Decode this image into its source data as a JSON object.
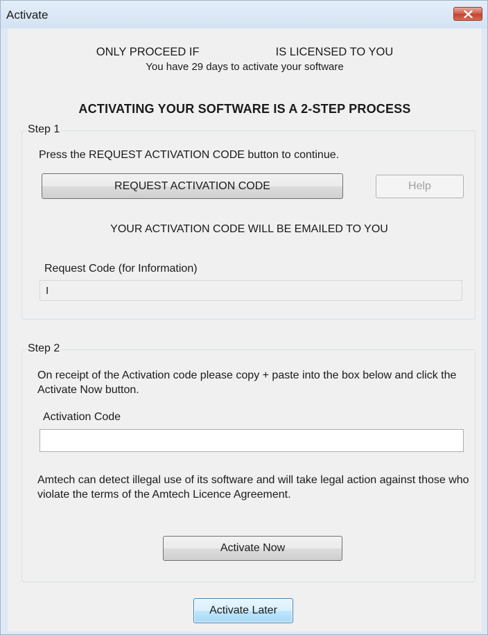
{
  "window": {
    "title": "Activate"
  },
  "header": {
    "warning_left": "ONLY PROCEED IF",
    "warning_right": "IS LICENSED TO YOU",
    "days_remaining": "You have 29 days to activate your software",
    "process_heading": "ACTIVATING YOUR SOFTWARE IS A 2-STEP PROCESS"
  },
  "step1": {
    "legend": "Step 1",
    "instruction": "Press the REQUEST ACTIVATION CODE button to continue.",
    "request_button": "REQUEST ACTIVATION CODE",
    "help_button": "Help",
    "email_notice": "YOUR ACTIVATION CODE WILL BE EMAILED TO YOU",
    "request_code_label": "Request Code (for Information)",
    "request_code_value": "I"
  },
  "step2": {
    "legend": "Step 2",
    "instruction": "On receipt of the Activation code please copy + paste into the box below and click the Activate Now button.",
    "activation_code_label": "Activation Code",
    "activation_code_value": "",
    "legal_notice": "Amtech can detect illegal use of its software and will take legal action against those who violate the terms of the Amtech Licence Agreement.",
    "activate_now_button": "Activate Now"
  },
  "footer": {
    "activate_later_button": "Activate Later"
  },
  "colors": {
    "close_button": "#c4412f",
    "dialog_background": "#f0f0f0",
    "frame": "#dfe9f5"
  },
  "icons": {
    "close": "close-icon"
  }
}
